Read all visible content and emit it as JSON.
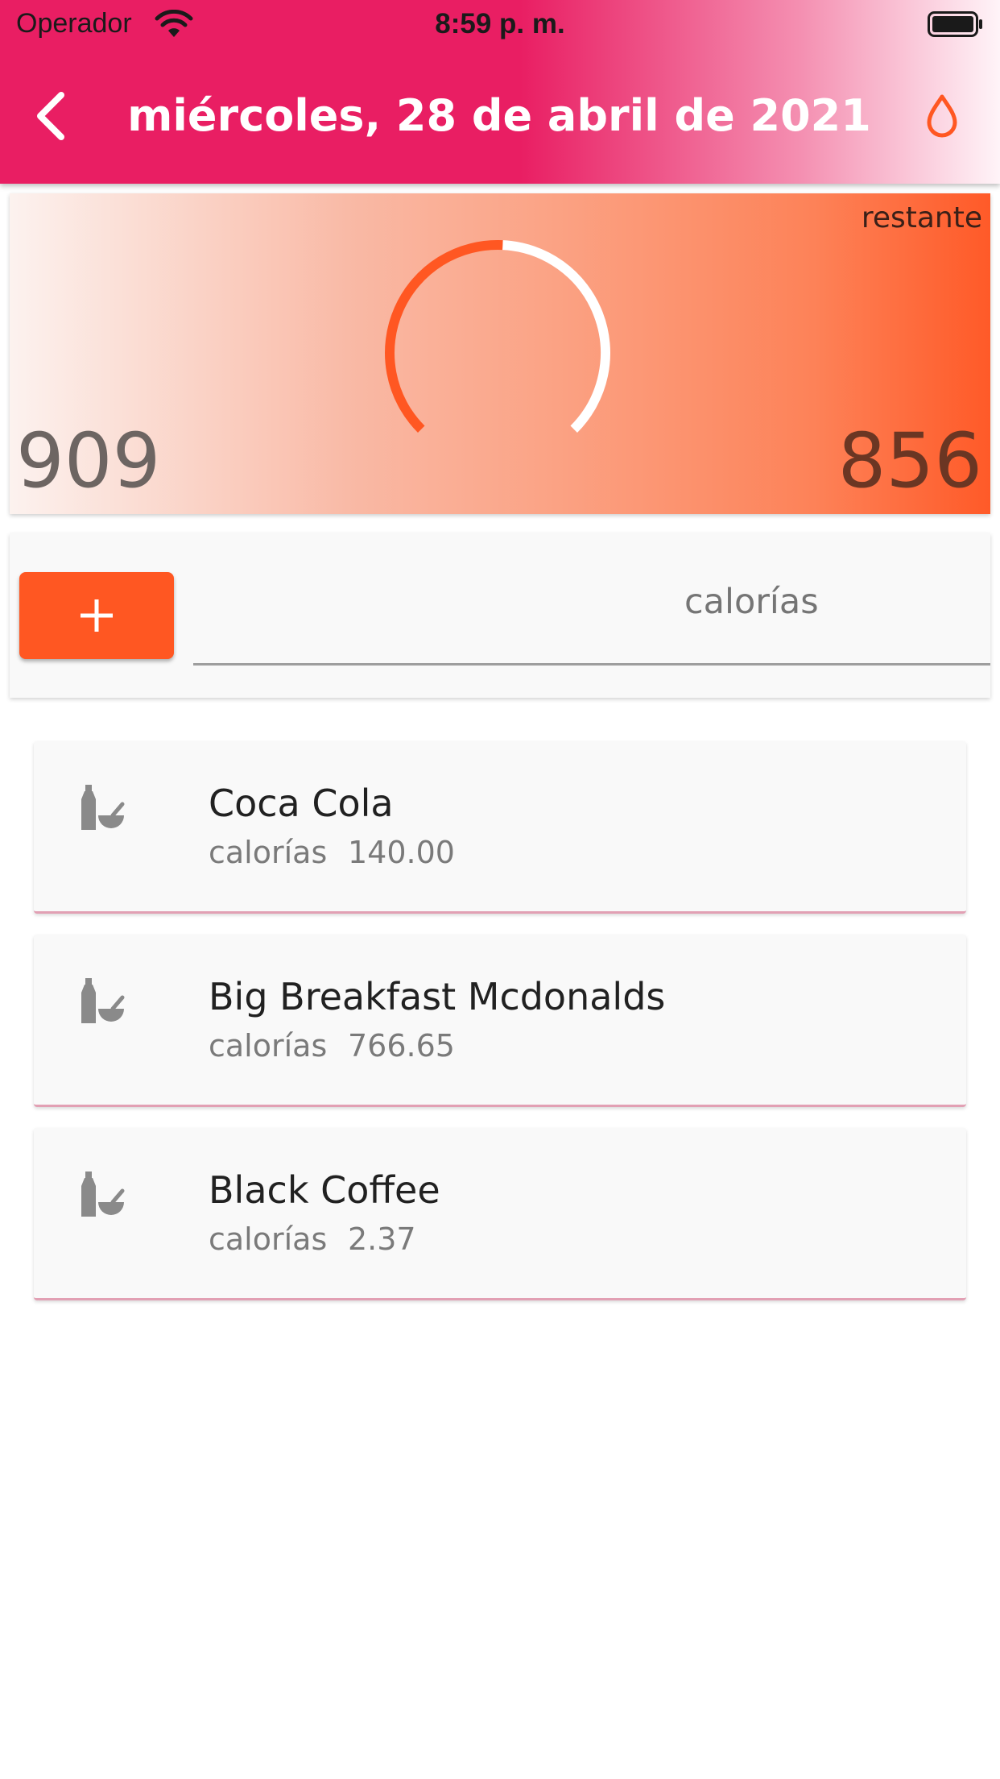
{
  "status_bar": {
    "carrier": "Operador",
    "time": "8:59 p. m.",
    "wifi_icon": "wifi-icon",
    "battery_icon": "battery-icon"
  },
  "header": {
    "title": "miércoles, 28 de abril de 2021",
    "back_icon": "chevron-left-icon",
    "water_icon": "water-drop-icon",
    "color": "#e91e63"
  },
  "summary": {
    "remaining_label": "restante",
    "consumed": "909",
    "remaining": "856",
    "progress": 0.51,
    "gauge_color": "#ff5722"
  },
  "add_form": {
    "add_icon": "plus-icon",
    "food_value": "",
    "calories_label": "calorías",
    "accent": "#ff5722"
  },
  "foods": [
    {
      "name": "Coca Cola",
      "calories_label": "calorías",
      "calories": "140.00",
      "icon": "bottle-bowl-icon"
    },
    {
      "name": "Big Breakfast Mcdonalds",
      "calories_label": "calorías",
      "calories": "766.65",
      "icon": "bottle-bowl-icon"
    },
    {
      "name": "Black Coffee",
      "calories_label": "calorías",
      "calories": "2.37",
      "icon": "bottle-bowl-icon"
    }
  ]
}
